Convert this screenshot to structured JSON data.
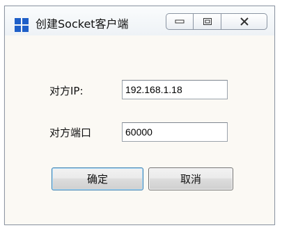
{
  "window": {
    "title": "创建Socket客户端"
  },
  "form": {
    "ip_label": "对方IP:",
    "ip_value": "192.168.1.18",
    "port_label": "对方端口",
    "port_value": "60000"
  },
  "buttons": {
    "ok_label": "确定",
    "cancel_label": "取消"
  },
  "icons": {
    "app": "windows-logo-icon",
    "minimize": "minimize-icon",
    "maximize": "maximize-icon",
    "close": "close-icon"
  },
  "colors": {
    "app_icon": "#1f5fc8",
    "default_button_border": "#3c7fb1"
  }
}
